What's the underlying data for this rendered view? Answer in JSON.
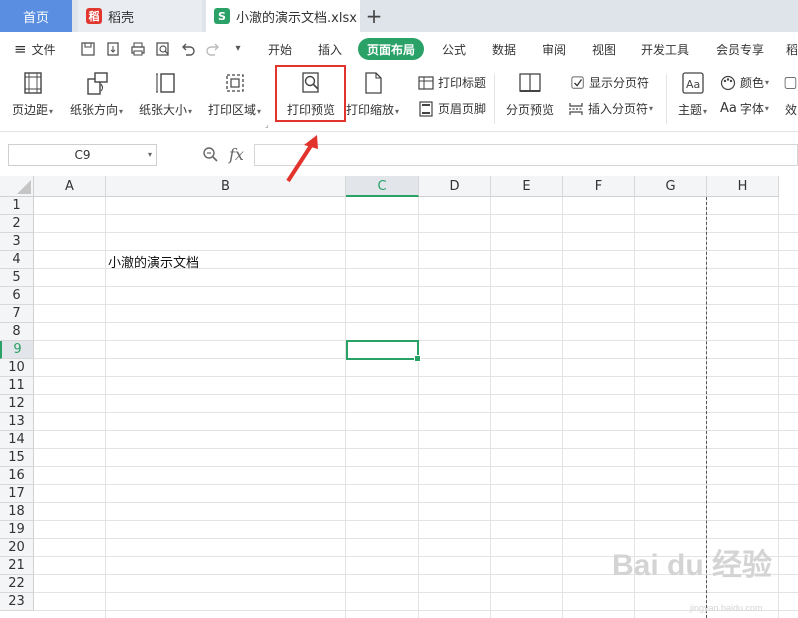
{
  "tabs": {
    "home": "首页",
    "daoke": "稻壳",
    "file": "小澈的演示文档.xlsx",
    "add": "+"
  },
  "menu": {
    "file": "文件",
    "items": [
      "开始",
      "插入",
      "页面布局",
      "公式",
      "数据",
      "审阅",
      "视图",
      "开发工具",
      "会员专享",
      "稻"
    ],
    "active": "页面布局"
  },
  "ribbon": {
    "margins": "页边距",
    "orientation": "纸张方向",
    "size": "纸张大小",
    "print_area": "打印区域",
    "print_preview": "打印预览",
    "print_scale": "打印缩放",
    "print_titles": "打印标题",
    "header_footer": "页眉页脚",
    "page_break_preview": "分页预览",
    "show_page_breaks": "显示分页符",
    "insert_page_break": "插入分页符",
    "theme": "主题",
    "colors": "颜色",
    "fonts": "字体",
    "effects": "效"
  },
  "formula_bar": {
    "name_box": "C9",
    "fx": "fx",
    "formula": ""
  },
  "grid": {
    "columns": [
      "A",
      "B",
      "C",
      "D",
      "E",
      "F",
      "G",
      "H"
    ],
    "rows": [
      "1",
      "2",
      "3",
      "4",
      "5",
      "6",
      "7",
      "8",
      "9",
      "10",
      "11",
      "12",
      "13",
      "14",
      "15",
      "16",
      "17",
      "18",
      "19",
      "20",
      "21",
      "22",
      "23"
    ],
    "selected_column": "C",
    "selected_row": "9",
    "cell_B4": "小澈的演示文档"
  },
  "watermark": {
    "main": "Bai du 经验",
    "sub": "jingyan.baidu.com"
  },
  "colors": {
    "accent_green": "#2aa167",
    "highlight_red": "#e2332c",
    "home_tab_blue": "#5a8ee0"
  }
}
